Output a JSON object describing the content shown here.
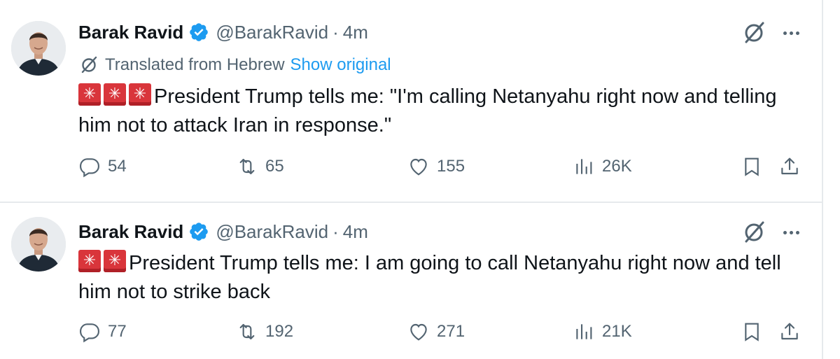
{
  "tweets": [
    {
      "author_name": "Barak Ravid",
      "handle": "@BarakRavid",
      "separator": "·",
      "time": "4m",
      "translated_label": "Translated from Hebrew",
      "show_original_label": "Show original",
      "text": "President Trump tells me: \"I'm calling Netanyahu right now and telling him not to attack Iran in response.\"",
      "siren_count": 3,
      "replies": "54",
      "reposts": "65",
      "likes": "155",
      "views": "26K"
    },
    {
      "author_name": "Barak Ravid",
      "handle": "@BarakRavid",
      "separator": "·",
      "time": "4m",
      "text": "President Trump tells me: I am going to call Netanyahu right now and tell him not to strike back",
      "siren_count": 2,
      "replies": "77",
      "reposts": "192",
      "likes": "271",
      "views": "21K"
    }
  ],
  "icons": {
    "verified": "verified-badge-icon",
    "grok": "grok-icon",
    "more": "more-options-icon",
    "siren": "police-light-emoji",
    "reply": "reply-icon",
    "repost": "repost-icon",
    "like": "heart-icon",
    "views": "views-chart-icon",
    "bookmark": "bookmark-icon",
    "share": "share-icon"
  },
  "colors": {
    "text": "#0f1419",
    "secondary": "#536471",
    "link": "#1d9bf0",
    "verified": "#1d9bf0",
    "siren": "#d9353b",
    "divider": "#e6e9ec"
  }
}
